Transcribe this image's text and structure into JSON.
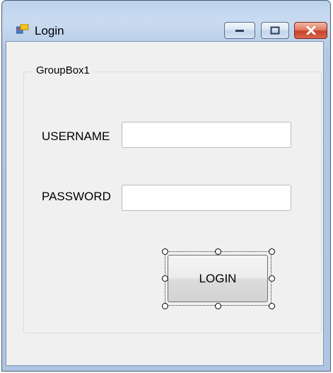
{
  "window": {
    "title": "Login",
    "icons": {
      "app": "form-icon",
      "minimize": "minimize-icon",
      "maximize": "maximize-icon",
      "close": "close-icon"
    },
    "colors": {
      "close_button": "#c8422a",
      "frame": "#b2c9e6"
    }
  },
  "form": {
    "group_title": "GroupBox1",
    "username_label": "USERNAME",
    "username_value": "",
    "password_label": "PASSWORD",
    "password_value": "",
    "login_button": "LOGIN",
    "login_button_selected": true
  }
}
